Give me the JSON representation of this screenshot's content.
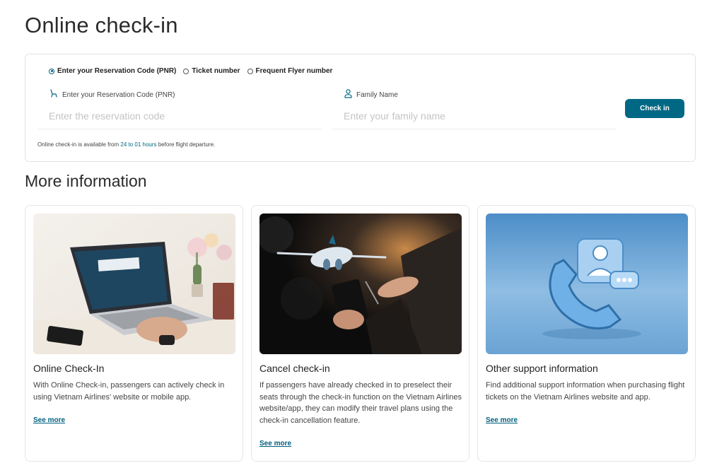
{
  "page": {
    "title": "Online check-in"
  },
  "checkin_form": {
    "options": [
      {
        "label": "Enter your Reservation Code (PNR)",
        "selected": true
      },
      {
        "label": "Ticket number",
        "selected": false
      },
      {
        "label": "Frequent Flyer number",
        "selected": false
      }
    ],
    "pnr_field": {
      "label": "Enter your Reservation Code (PNR)",
      "placeholder": "Enter the reservation code",
      "icon": "seat-icon"
    },
    "family_field": {
      "label": "Family Name",
      "placeholder": "Enter your family name",
      "icon": "person-icon"
    },
    "submit_label": "Check in",
    "note_prefix": "Online check-in is available from ",
    "note_highlight": "24 to 01 hours",
    "note_suffix": " before flight departure."
  },
  "more_info": {
    "title": "More information",
    "cards": [
      {
        "title": "Online Check-In",
        "description": "With Online Check-in, passengers can actively check in using Vietnam Airlines' website or mobile app.",
        "link": "See more"
      },
      {
        "title": "Cancel check-in",
        "description": "If passengers have already checked in to preselect their seats through the check-in function on the Vietnam Airlines website/app, they can modify their travel plans using the check-in cancellation feature.",
        "link": "See more"
      },
      {
        "title": "Other support information",
        "description": "Find additional support information when purchasing flight tickets on the Vietnam Airlines website and app.",
        "link": "See more"
      }
    ]
  },
  "colors": {
    "primary": "#006885",
    "border": "#e3e3e3",
    "text": "#222222"
  }
}
